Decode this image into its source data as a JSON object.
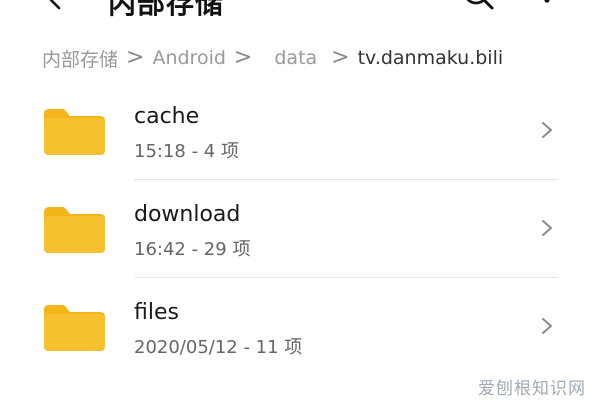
{
  "topbar": {
    "title": "内部存储"
  },
  "breadcrumb": {
    "items": [
      "内部存储",
      "Android",
      "data",
      "tv.danmaku.bili"
    ],
    "separator": ">"
  },
  "folders": [
    {
      "name": "cache",
      "meta": "15:18 - 4 项"
    },
    {
      "name": "download",
      "meta": "16:42 - 29 项"
    },
    {
      "name": "files",
      "meta": "2020/05/12 - 11 项"
    }
  ],
  "watermark": {
    "text": "爱刨根知识网"
  },
  "colors": {
    "folder": "#f6c02e",
    "folder_tab": "#f2b51a",
    "title": "#111111",
    "breadcrumb": "#9a9a9a",
    "breadcrumb_current": "#333333",
    "meta": "#666666",
    "chevron": "#8a8a8a"
  },
  "icons": {
    "back": "back-arrow-icon",
    "search": "search-icon",
    "more": "more-vertical-icon",
    "folder": "folder-icon",
    "chevron": "chevron-right-icon"
  }
}
